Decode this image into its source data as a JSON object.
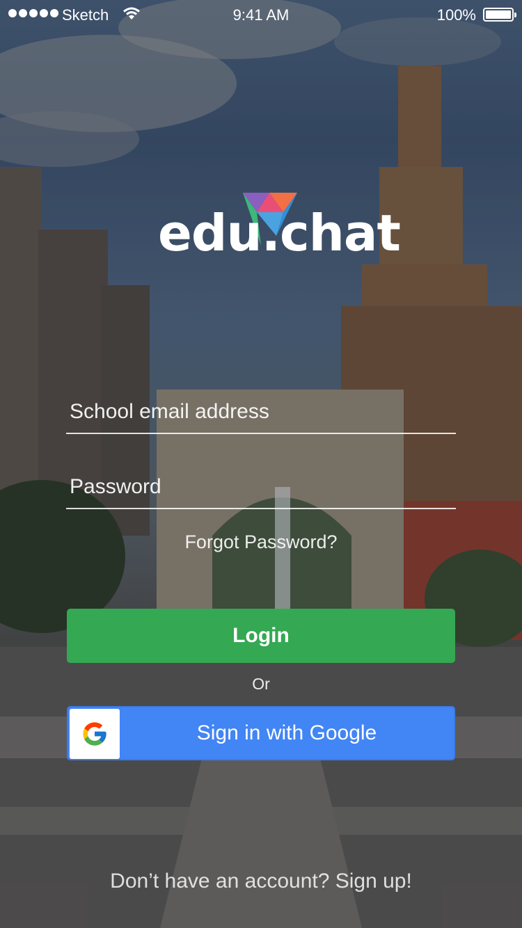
{
  "status_bar": {
    "carrier": "Sketch",
    "time": "9:41 AM",
    "battery": "100%"
  },
  "brand": {
    "name": "edu.chat",
    "gem_colors": [
      "#f36f45",
      "#8b5fbf",
      "#2f8fd8",
      "#3cb879"
    ]
  },
  "login_form": {
    "email_placeholder": "School email address",
    "password_placeholder": "Password",
    "forgot_label": "Forgot Password?",
    "login_label": "Login",
    "or_label": "Or",
    "google_label": "Sign in with Google",
    "signup_label": "Don’t have an account? Sign up!"
  },
  "colors": {
    "login_button": "#34a853",
    "google_button": "#4285f4"
  },
  "icons": [
    "signal-dots-icon",
    "wifi-icon",
    "battery-icon",
    "educhat-gem-logo-icon",
    "google-g-icon"
  ]
}
